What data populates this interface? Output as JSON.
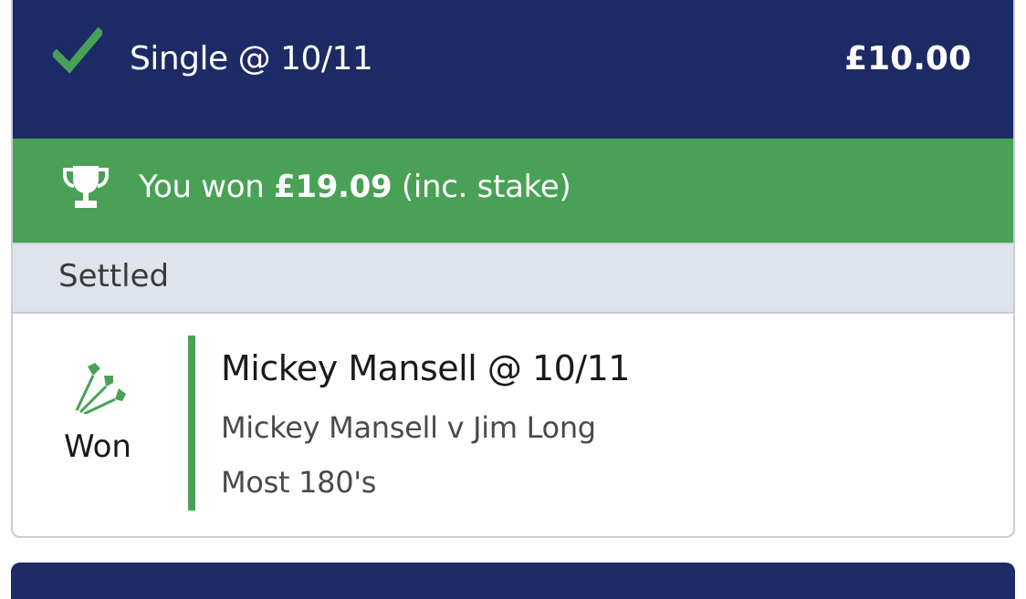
{
  "bet": {
    "type_label": "Single @ 10/11",
    "stake": "£10.00",
    "win_prefix": "You won ",
    "win_amount": "£19.09",
    "win_suffix": " (inc. stake)",
    "status": "Settled"
  },
  "selection": {
    "result": "Won",
    "name": "Mickey Mansell @ 10/11",
    "event": "Mickey Mansell v Jim Long",
    "market": "Most 180's"
  },
  "icons": {
    "header": "checkmark-icon",
    "banner": "trophy-icon",
    "sport": "darts-icon"
  },
  "colors": {
    "header_bg": "#1c2a66",
    "win_green": "#49a156",
    "status_bg": "#dfe3ec"
  }
}
